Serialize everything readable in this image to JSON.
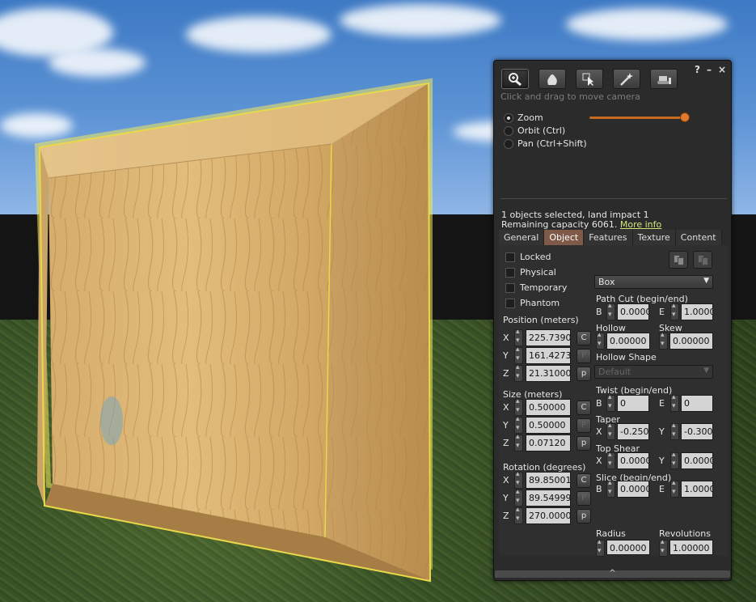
{
  "toolbar": {
    "tools": [
      "zoom-tool-icon",
      "grab-tool-icon",
      "select-tool-icon",
      "create-tool-icon",
      "land-tool-icon"
    ],
    "hint": "Click and drag to move camera",
    "help": "?",
    "minimize": "–",
    "close": "×"
  },
  "camera_modes": [
    {
      "label": "Zoom",
      "selected": true
    },
    {
      "label": "Orbit (Ctrl)",
      "selected": false
    },
    {
      "label": "Pan (Ctrl+Shift)",
      "selected": false
    }
  ],
  "zoom_slider": {
    "value": 1.0
  },
  "status": {
    "line1": "1 objects selected, land impact 1",
    "line2_prefix": "Remaining capacity 6061.",
    "more_info": "More info"
  },
  "tabs": [
    {
      "label": "General",
      "active": false
    },
    {
      "label": "Object",
      "active": true
    },
    {
      "label": "Features",
      "active": false
    },
    {
      "label": "Texture",
      "active": false
    },
    {
      "label": "Content",
      "active": false
    }
  ],
  "checkboxes": [
    "Locked",
    "Physical",
    "Temporary",
    "Phantom"
  ],
  "position": {
    "label": "Position (meters)",
    "x": "225.73903",
    "y": "161.42738",
    "z": "21.31000",
    "btn_x": "C",
    "btn_y": "P",
    "btn_z": "p"
  },
  "size": {
    "label": "Size (meters)",
    "x": "0.50000",
    "y": "0.50000",
    "z": "0.07120",
    "btn_x": "C",
    "btn_y": "P",
    "btn_z": "p"
  },
  "rotation": {
    "label": "Rotation (degrees)",
    "x": "89.85001",
    "y": "89.54999",
    "z": "270.00000",
    "btn_x": "C",
    "btn_y": "P",
    "btn_z": "p"
  },
  "axis": {
    "x": "X",
    "y": "Y",
    "z": "Z",
    "b": "B",
    "e": "E"
  },
  "shape": {
    "type": "Box",
    "path_cut_label": "Path Cut (begin/end)",
    "path_cut_b": "0.0000",
    "path_cut_e": "1.0000",
    "hollow_label": "Hollow",
    "hollow": "0.00000",
    "skew_label": "Skew",
    "skew": "0.00000",
    "hollow_shape_label": "Hollow Shape",
    "hollow_shape": "Default",
    "twist_label": "Twist (begin/end)",
    "twist_b": "0",
    "twist_e": "0",
    "taper_label": "Taper",
    "taper_x": "-0.2500",
    "taper_y": "-0.3000",
    "top_shear_label": "Top Shear",
    "top_shear_x": "0.0000",
    "top_shear_y": "0.0000",
    "slice_label": "Slice (begin/end)",
    "slice_b": "0.0000",
    "slice_e": "1.0000",
    "radius_label": "Radius",
    "radius": "0.00000",
    "revolutions_label": "Revolutions",
    "revolutions": "1.00000"
  },
  "footer": {
    "expand": "^"
  },
  "colors": {
    "accent": "#7f5a48",
    "slider": "#c56a1f",
    "link": "#d0e87a"
  }
}
